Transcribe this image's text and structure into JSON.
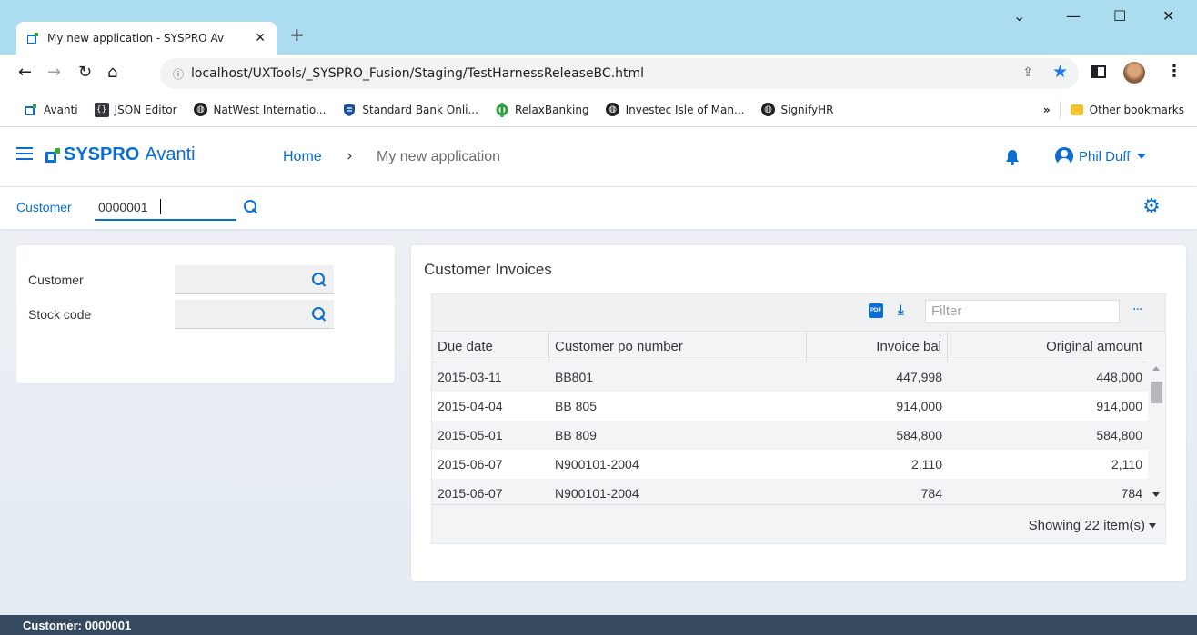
{
  "browser": {
    "tab_title": "My new application - SYSPRO Av",
    "new_tab": "+",
    "url": "localhost/UXTools/_SYSPRO_Fusion/Staging/TestHarnessReleaseBC.html",
    "bookmarks": [
      {
        "label": "Avanti",
        "icon": "avanti-icon"
      },
      {
        "label": "JSON Editor",
        "icon": "json-icon"
      },
      {
        "label": "NatWest Internatio...",
        "icon": "globe-icon"
      },
      {
        "label": "Standard Bank Onli...",
        "icon": "shield-icon"
      },
      {
        "label": "RelaxBanking",
        "icon": "relax-icon"
      },
      {
        "label": "Investec Isle of Man...",
        "icon": "globe-icon"
      },
      {
        "label": "SignifyHR",
        "icon": "globe-icon"
      }
    ],
    "bookmarks_overflow": "»",
    "other_bookmarks": "Other bookmarks",
    "colors": {
      "tabstrip": "#abdcf0",
      "star": "#1a73e8"
    }
  },
  "app": {
    "brand_bold": "SYSPRO",
    "brand_light": "Avanti",
    "breadcrumb_home": "Home",
    "breadcrumb_sep": "›",
    "breadcrumb_current": "My new application",
    "user_name": "Phil Duff",
    "accent_color": "#0a6ed1"
  },
  "filter": {
    "label": "Customer",
    "value": "0000001"
  },
  "left_form": {
    "fields": [
      {
        "label": "Customer",
        "value": ""
      },
      {
        "label": "Stock code",
        "value": ""
      }
    ]
  },
  "invoices": {
    "title": "Customer Invoices",
    "filter_placeholder": "Filter",
    "pdf_label": "PDF",
    "more": "···",
    "columns": [
      "Due date",
      "Customer po number",
      "Invoice bal",
      "Original amount"
    ],
    "rows": [
      [
        "2015-03-11",
        "BB801",
        "447,998",
        "448,000"
      ],
      [
        "2015-04-04",
        "BB 805",
        "914,000",
        "914,000"
      ],
      [
        "2015-05-01",
        "BB 809",
        "584,800",
        "584,800"
      ],
      [
        "2015-06-07",
        "N900101-2004",
        "2,110",
        "2,110"
      ],
      [
        "2015-06-07",
        "N900101-2004",
        "784",
        "784"
      ]
    ],
    "showing": "Showing 22 item(s)"
  },
  "status_bar": {
    "text": "Customer: 0000001"
  }
}
